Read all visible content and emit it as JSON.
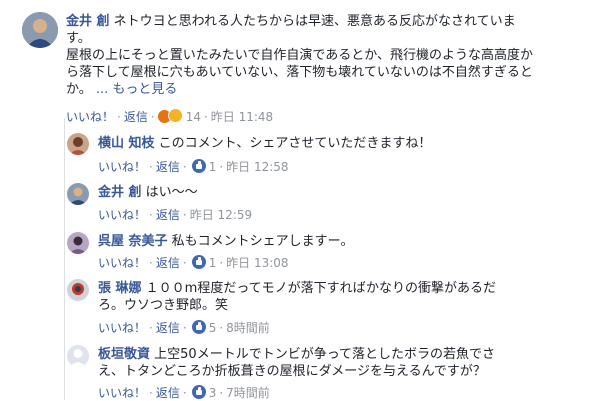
{
  "main_comment": {
    "author": "金井 創",
    "lines": [
      " ネトウヨと思われる人たちからは早速、悪意ある反応がなされていま",
      "す。",
      "屋根の上にそっと置いたみたいで自作自演であるとか、飛行機のような高高度か",
      "ら落下して屋根に穴もあいていない、落下物も壊れていないのは不自然すぎると",
      "か。"
    ],
    "see_more": "... もっと見る",
    "like": "いいね！",
    "reply": "返信",
    "reaction_count": "14",
    "time": "昨日 11:48"
  },
  "replies": [
    {
      "author": "横山 知枝",
      "text": "このコメント、シェアさせていただきますね！",
      "like": "いいね！",
      "reply": "返信",
      "likes": "1",
      "time": "昨日 12:58"
    },
    {
      "author": "金井 創",
      "text": "はい〜〜",
      "like": "いいね！",
      "reply": "返信",
      "likes": "",
      "time": "昨日 12:59"
    },
    {
      "author": "呉屋 奈美子",
      "text": "私もコメントシェアしますー。",
      "like": "いいね！",
      "reply": "返信",
      "likes": "1",
      "time": "昨日 13:08"
    },
    {
      "author": "張 琳娜",
      "text_line1": "１００m程度だってモノが落下すればかなりの衝撃があるだ",
      "text_line2": "ろ。ウソつき野郎。笑",
      "like": "いいね！",
      "reply": "返信",
      "likes": "5",
      "time": "8時間前"
    },
    {
      "author": "板垣敬資",
      "text_line1": "上空50メートルでトンビが争って落としたボラの若魚でさ",
      "text_line2": "え、トタンどころか折板葺きの屋根にダメージを与えるんですが？",
      "like": "いいね！",
      "reply": "返信",
      "likes": "3",
      "time": "7時間前"
    }
  ],
  "colors": {
    "link": "#385898",
    "meta": "#90949c",
    "like_blue": "#4267b2"
  }
}
